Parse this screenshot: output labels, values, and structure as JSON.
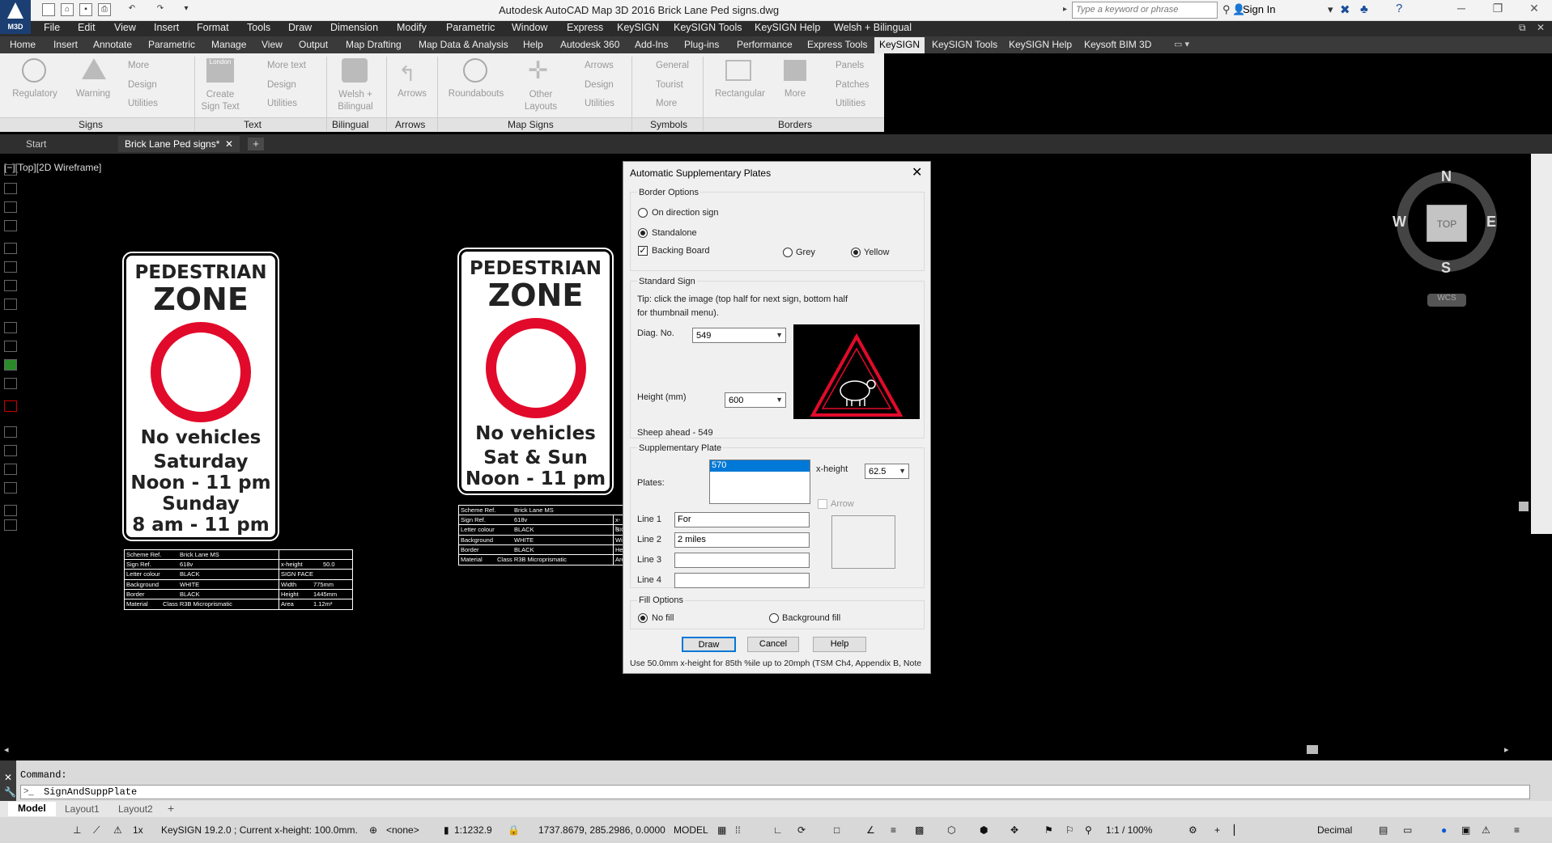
{
  "window": {
    "title": "Autodesk AutoCAD Map 3D 2016    Brick Lane Ped signs.dwg",
    "app_badge": "M3D",
    "search_placeholder": "Type a keyword or phrase",
    "sign_in": "Sign In"
  },
  "menubar": [
    "File",
    "Edit",
    "View",
    "Insert",
    "Format",
    "Tools",
    "Draw",
    "Dimension",
    "Modify",
    "Parametric",
    "Window",
    "Express",
    "KeySIGN",
    "KeySIGN Tools",
    "KeySIGN Help",
    "Welsh + Bilingual"
  ],
  "ribbon_tabs": [
    "Home",
    "Insert",
    "Annotate",
    "Parametric",
    "Manage",
    "View",
    "Output",
    "Map Drafting",
    "Map Data & Analysis",
    "Help",
    "Autodesk 360",
    "Add-Ins",
    "Plug-ins",
    "Performance",
    "Express Tools",
    "KeySIGN",
    "KeySIGN Tools",
    "KeySIGN Help",
    "Keysoft BIM 3D"
  ],
  "ribbon_active_tab": "KeySIGN",
  "ribbon": {
    "regulatory": "Regulatory",
    "warning": "Warning",
    "more": "More",
    "design": "Design",
    "utilities": "Utilities",
    "create_sign_text": "Create\nSign Text",
    "more_text": "More text",
    "welsh_bilingual": "Welsh +\nBilingual",
    "arrows": "Arrows",
    "roundabouts": "Roundabouts",
    "other_layouts": "Other\nLayouts",
    "general": "General",
    "tourist": "Tourist",
    "rectangular": "Rectangular",
    "panels": "Panels",
    "patches": "Patches",
    "london_badge": "London"
  },
  "ribbon_panels": [
    "Signs",
    "Text",
    "Bilingual",
    "Arrows",
    "Map Signs",
    "Symbols",
    "Borders"
  ],
  "file_tabs": [
    "Start",
    "Brick Lane Ped signs*"
  ],
  "viewport_label": "[−][Top][2D Wireframe]",
  "signs": [
    {
      "line1": "PEDESTRIAN",
      "line2": "ZONE",
      "line3": "No vehicles",
      "line4": "Saturday",
      "line5": "Noon - 11 pm",
      "line6": "Sunday",
      "line7": "8 am - 11 pm"
    },
    {
      "line1": "PEDESTRIAN",
      "line2": "ZONE",
      "line3": "No vehicles",
      "line4": "Sat & Sun",
      "line5": "Noon - 11 pm"
    }
  ],
  "schedules": [
    {
      "rows": [
        [
          "Scheme Ref.",
          "Brick Lane MS",
          "",
          ""
        ],
        [
          "Sign    Ref.",
          "618v",
          "x-height",
          "50.0"
        ],
        [
          "Letter colour",
          "BLACK",
          "SIGN FACE",
          ""
        ],
        [
          "Background",
          "WHITE",
          "Width",
          "775mm"
        ],
        [
          "Border",
          "BLACK",
          "Height",
          "1445mm"
        ],
        [
          "Material",
          "Class R3B Microprismatic",
          "Area",
          "1.12m²"
        ]
      ]
    },
    {
      "rows": [
        [
          "Scheme Ref.",
          "Brick Lane MS",
          "",
          ""
        ],
        [
          "Sign    Ref.",
          "618v",
          "x-h",
          ""
        ],
        [
          "Letter colour",
          "BLACK",
          "SIG",
          ""
        ],
        [
          "Background",
          "WHITE",
          "Wid",
          ""
        ],
        [
          "Border",
          "BLACK",
          "Hei",
          ""
        ],
        [
          "Material",
          "Class R3B Microprismatic",
          "Are",
          ""
        ]
      ]
    }
  ],
  "compass": {
    "n": "N",
    "s": "S",
    "e": "E",
    "w": "W",
    "top": "TOP",
    "wcs": "WCS"
  },
  "dialog": {
    "title": "Automatic Supplementary Plates",
    "border_options": "Border Options",
    "on_direction_sign": "On direction sign",
    "standalone": "Standalone",
    "backing_board": "Backing Board",
    "grey": "Grey",
    "yellow": "Yellow",
    "standard_sign": "Standard Sign",
    "tip_line1": "Tip: click the image (top half for next sign, bottom half",
    "tip_line2": "for thumbnail menu).",
    "diag_no_label": "Diag. No.",
    "diag_no_value": "549",
    "height_label": "Height (mm)",
    "height_value": "600",
    "sign_name": "Sheep ahead - 549",
    "supplementary_plate": "Supplementary Plate",
    "plates_label": "Plates:",
    "plates_selected": "570",
    "x_height_label": "x-height",
    "x_height_value": "62.5",
    "arrow_label": "Arrow",
    "line1_label": "Line 1",
    "line1_value": "For",
    "line2_label": "Line 2",
    "line2_value": "2 miles",
    "line3_label": "Line 3",
    "line4_label": "Line 4",
    "fill_options": "Fill Options",
    "no_fill": "No fill",
    "background_fill": "Background fill",
    "draw": "Draw",
    "cancel": "Cancel",
    "help": "Help",
    "note": "Use 50.0mm x-height for 85th %ile up to 20mph (TSM Ch4, Appendix B, Note"
  },
  "command": {
    "prompt": "Command:",
    "history": "SignAndSuppPlate"
  },
  "layout_tabs": [
    "Model",
    "Layout1",
    "Layout2"
  ],
  "status": {
    "scale_1x": "1x",
    "keysign": "KeySIGN 19.2.0 ;  Current x-height: 100.0mm.",
    "none": "<none>",
    "scale": "1:1232.9",
    "coords": "1737.8679, 285.2986, 0.0000",
    "model": "MODEL",
    "annot_scale": "1:1 / 100%",
    "units": "Decimal"
  }
}
